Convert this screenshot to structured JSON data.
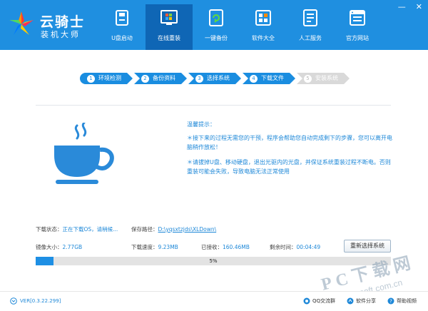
{
  "app": {
    "title": "云骑士",
    "subtitle": "装机大师"
  },
  "nav": [
    {
      "label": "U盘启动",
      "icon": "usb-icon"
    },
    {
      "label": "在线重装",
      "icon": "windows-icon",
      "active": true
    },
    {
      "label": "一键备份",
      "icon": "backup-icon"
    },
    {
      "label": "软件大全",
      "icon": "software-icon"
    },
    {
      "label": "人工服务",
      "icon": "service-icon"
    },
    {
      "label": "官方网站",
      "icon": "website-icon"
    }
  ],
  "window": {
    "minimize": "—",
    "close": "✕"
  },
  "steps": [
    {
      "num": "1",
      "label": "环境检测"
    },
    {
      "num": "2",
      "label": "备份资料"
    },
    {
      "num": "3",
      "label": "选择系统"
    },
    {
      "num": "4",
      "label": "下载文件"
    },
    {
      "num": "5",
      "label": "安装系统"
    }
  ],
  "tips": {
    "title": "温馨提示：",
    "items": [
      "＊接下来的过程无需您的干预，程序会帮助您自动完成剩下的步骤，您可以离开电脑稍作放松！",
      "＊请拔掉U盘、移动硬盘，退出光驱内的光盘，并保证系统重装过程不断电。否则重装可能会失败，导致电脑无法正常使用"
    ]
  },
  "status": {
    "download_label": "下载状态：",
    "download_value": "正在下载OS，请稍候...",
    "path_label": "保存路径：",
    "path_value": "D:\\yqsxtzjds\\XLDown\\",
    "image_size_label": "镜像大小：",
    "image_size_value": "2.77GB",
    "speed_label": "下载速度：",
    "speed_value": "9.23MB",
    "received_label": "已接收：",
    "received_value": "160.46MB",
    "remaining_label": "剩余时间：",
    "remaining_value": "00:04:49",
    "reselect_button": "重新选择系统"
  },
  "progress": {
    "percent": 5,
    "label": "5%"
  },
  "footer": {
    "version": "VER[0.3.22.299]",
    "links": [
      {
        "label": "QQ交流群",
        "icon": "qq-icon"
      },
      {
        "label": "软件分享",
        "icon": "share-icon"
      },
      {
        "label": "帮助视频",
        "icon": "help-icon"
      }
    ]
  },
  "watermark": {
    "text": "PC下载网",
    "url": "www.pcsoft.com.cn"
  },
  "colors": {
    "header": "#1f8fe0",
    "active_nav": "#0f66b5",
    "accent": "#1e88d8",
    "step_disabled": "#d9d9d9"
  }
}
